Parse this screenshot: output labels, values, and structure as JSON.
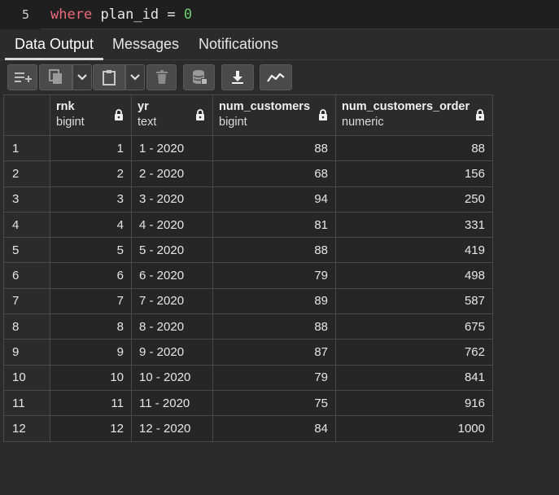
{
  "editor": {
    "line_number": "5",
    "keyword": "where",
    "identifier": "plan_id",
    "operator": "=",
    "value": "0"
  },
  "tabs": [
    {
      "label": "Data Output",
      "active": true
    },
    {
      "label": "Messages",
      "active": false
    },
    {
      "label": "Notifications",
      "active": false
    }
  ],
  "toolbar": {
    "icons": [
      "add-row-icon",
      "copy-icon",
      "copy-dropdown-icon",
      "paste-icon",
      "paste-dropdown-icon",
      "delete-icon",
      "save-data-icon",
      "download-icon",
      "graph-icon"
    ]
  },
  "columns": [
    {
      "name": "rnk",
      "type": "bigint"
    },
    {
      "name": "yr",
      "type": "text"
    },
    {
      "name": "num_customers",
      "type": "bigint"
    },
    {
      "name": "num_customers_order",
      "type": "numeric"
    }
  ],
  "rows": [
    [
      "1",
      "1",
      "1 - 2020",
      "88",
      "88"
    ],
    [
      "2",
      "2",
      "2 - 2020",
      "68",
      "156"
    ],
    [
      "3",
      "3",
      "3 - 2020",
      "94",
      "250"
    ],
    [
      "4",
      "4",
      "4 - 2020",
      "81",
      "331"
    ],
    [
      "5",
      "5",
      "5 - 2020",
      "88",
      "419"
    ],
    [
      "6",
      "6",
      "6 - 2020",
      "79",
      "498"
    ],
    [
      "7",
      "7",
      "7 - 2020",
      "89",
      "587"
    ],
    [
      "8",
      "8",
      "8 - 2020",
      "88",
      "675"
    ],
    [
      "9",
      "9",
      "9 - 2020",
      "87",
      "762"
    ],
    [
      "10",
      "10",
      "10 - 2020",
      "79",
      "841"
    ],
    [
      "11",
      "11",
      "11 - 2020",
      "75",
      "916"
    ],
    [
      "12",
      "12",
      "12 - 2020",
      "84",
      "1000"
    ]
  ]
}
